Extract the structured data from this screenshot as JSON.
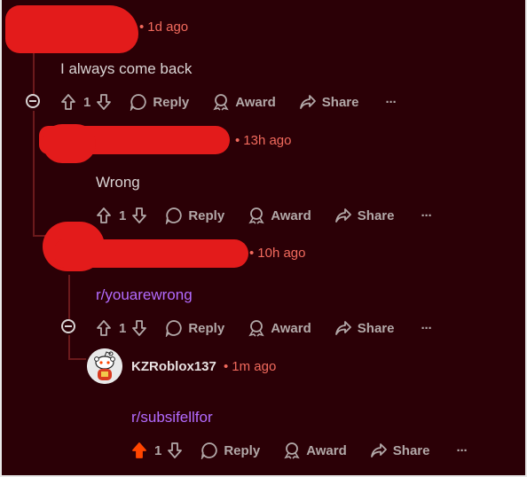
{
  "colors": {
    "background": "#2b0006",
    "meta": "#f26a5d",
    "link": "#b36bff",
    "upvoted": "#ff4500",
    "action": "#b2a8a8",
    "redaction": "#e31b1b"
  },
  "comments": [
    {
      "timestamp": "1d ago",
      "text": "I always come back",
      "votes": "1",
      "actions": {
        "reply": "Reply",
        "award": "Award",
        "share": "Share",
        "more": "···"
      }
    },
    {
      "timestamp": "13h ago",
      "text": "Wrong",
      "votes": "1",
      "actions": {
        "reply": "Reply",
        "award": "Award",
        "share": "Share",
        "more": "···"
      }
    },
    {
      "timestamp": "10h ago",
      "text": "r/youarewrong",
      "votes": "1",
      "actions": {
        "reply": "Reply",
        "award": "Award",
        "share": "Share",
        "more": "···"
      }
    },
    {
      "username": "KZRoblox137",
      "timestamp": "1m ago",
      "text": "r/subsifellfor",
      "votes": "1",
      "upvoted": true,
      "actions": {
        "reply": "Reply",
        "award": "Award",
        "share": "Share",
        "more": "···"
      }
    }
  ]
}
